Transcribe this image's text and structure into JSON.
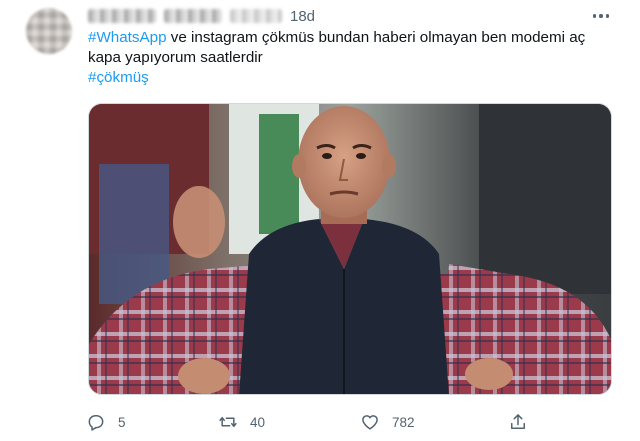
{
  "tweet": {
    "time": "18d",
    "body": {
      "hashtag1": "#WhatsApp",
      "line1_rest": "ve instagram çökmüs bundan haberi olmayan ben modemi aç",
      "line2": "kapa yapıyorum saatlerdir",
      "hashtag2": "#çökmüş"
    },
    "actions": {
      "reply_count": "5",
      "retweet_count": "40",
      "like_count": "782"
    },
    "icons": {
      "reply": "reply-icon",
      "retweet": "retweet-icon",
      "like": "heart-icon",
      "share": "share-icon",
      "more": "more-dots-icon"
    },
    "colors": {
      "hashtag": "#1d9bf0",
      "secondary_text": "#536471",
      "primary_text": "#0f1419"
    }
  }
}
